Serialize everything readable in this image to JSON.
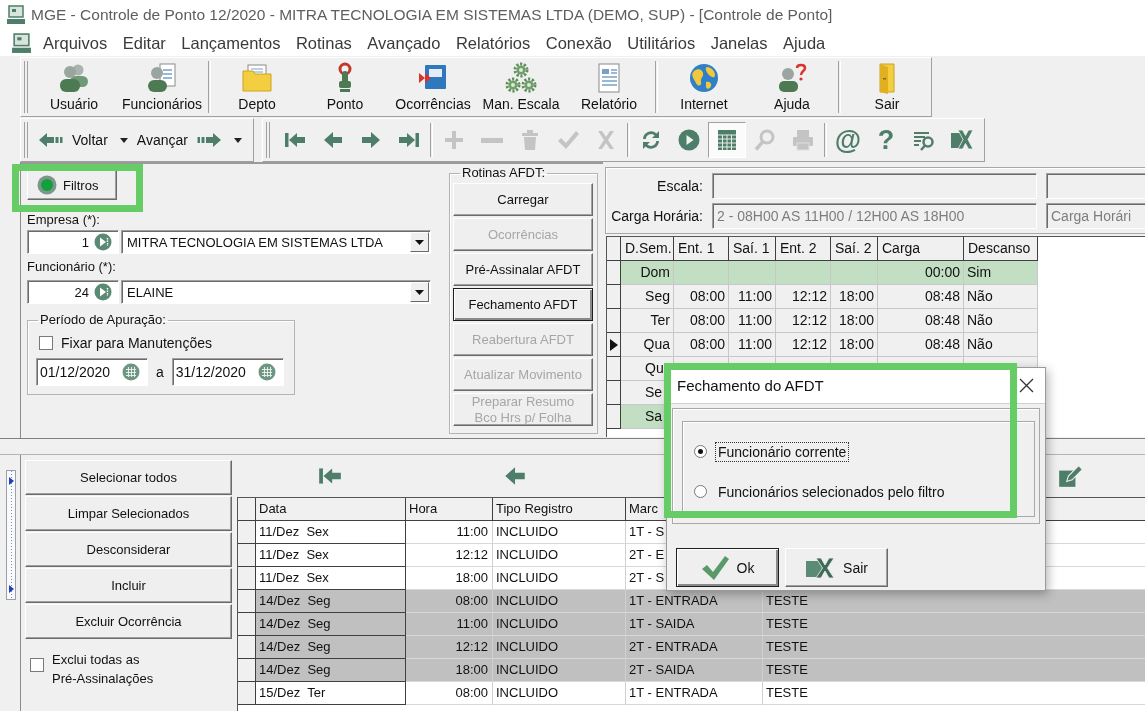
{
  "window": {
    "title": "MGE - Controle de Ponto 12/2020 - MITRA TECNOLOGIA EM SISTEMAS LTDA (DEMO, SUP) - [Controle de Ponto]"
  },
  "menu": [
    {
      "label": "Arquivos"
    },
    {
      "label": "Editar"
    },
    {
      "label": "Lançamentos"
    },
    {
      "label": "Rotinas"
    },
    {
      "label": "Avançado"
    },
    {
      "label": "Relatórios"
    },
    {
      "label": "Conexão"
    },
    {
      "label": "Utilitários"
    },
    {
      "label": "Janelas"
    },
    {
      "label": "Ajuda"
    }
  ],
  "main_toolbar": [
    [
      {
        "label": "Usuário",
        "kind": "users"
      },
      {
        "label": "Funcionários",
        "kind": "employees"
      }
    ],
    [
      {
        "label": "Depto",
        "kind": "department"
      },
      {
        "label": "Ponto",
        "kind": "punch"
      },
      {
        "label": "Ocorrências",
        "kind": "occurrences"
      },
      {
        "label": "Man. Escala",
        "kind": "schedule"
      },
      {
        "label": "Relatório",
        "kind": "report"
      }
    ],
    [
      {
        "label": "Internet",
        "kind": "internet"
      },
      {
        "label": "Ajuda",
        "kind": "help"
      }
    ],
    [
      {
        "label": "Sair",
        "kind": "exit"
      }
    ]
  ],
  "nav_toolbar": [
    {
      "label": "Voltar",
      "kind": "back"
    },
    {
      "label": "Avançar",
      "kind": "forward"
    }
  ],
  "record_toolbar": [
    [
      {
        "kind": "first",
        "disabled": false,
        "pressed": false
      },
      {
        "kind": "prev",
        "disabled": false,
        "pressed": false
      },
      {
        "kind": "next",
        "disabled": false,
        "pressed": false
      },
      {
        "kind": "last",
        "disabled": false,
        "pressed": false
      }
    ],
    [
      {
        "kind": "add",
        "disabled": true,
        "pressed": false
      },
      {
        "kind": "remove",
        "disabled": true,
        "pressed": false
      },
      {
        "kind": "delete",
        "disabled": true,
        "pressed": false
      },
      {
        "kind": "confirm",
        "disabled": true,
        "pressed": false
      },
      {
        "kind": "cancel",
        "disabled": true,
        "pressed": false
      }
    ],
    [
      {
        "kind": "refresh",
        "disabled": false,
        "pressed": false
      },
      {
        "kind": "run",
        "disabled": false,
        "pressed": false
      },
      {
        "kind": "grid",
        "disabled": false,
        "pressed": true
      },
      {
        "kind": "find",
        "disabled": true,
        "pressed": false
      },
      {
        "kind": "print",
        "disabled": true,
        "pressed": false
      }
    ],
    [
      {
        "kind": "email",
        "text": "@",
        "disabled": false,
        "pressed": false
      },
      {
        "kind": "help",
        "text": "?",
        "disabled": false,
        "pressed": false
      },
      {
        "kind": "search_list",
        "disabled": false,
        "pressed": false
      },
      {
        "kind": "export",
        "disabled": false,
        "pressed": false
      }
    ]
  ],
  "filters": {
    "button": {
      "label": "Filtros",
      "highlighted": true
    },
    "company": {
      "label": "Empresa (*):",
      "code": "1",
      "name": "MITRA TECNOLOGIA EM SISTEMAS LTDA"
    },
    "employee": {
      "label": "Funcionário (*):",
      "code": "24",
      "name": "ELAINE"
    },
    "period": {
      "title": "Período de Apuração:",
      "fixed": {
        "label": "Fixar para Manutenções",
        "checked": false
      },
      "from": "01/12/2020",
      "separator": "a",
      "to": "31/12/2020"
    }
  },
  "afdt_routines": {
    "title": "Rotinas AFDT:",
    "buttons": [
      {
        "label": "Carregar",
        "disabled": false,
        "focused": false
      },
      {
        "label": "Ocorrências",
        "disabled": true,
        "focused": false
      },
      {
        "label": "Pré-Assinalar AFDT",
        "disabled": false,
        "focused": false
      },
      {
        "label": "Fechamento AFDT",
        "disabled": false,
        "focused": true
      },
      {
        "label": "Reabertura AFDT",
        "disabled": true,
        "focused": false
      },
      {
        "label": "Atualizar Movimento",
        "disabled": true,
        "focused": false
      },
      {
        "label": "Preparar Resumo\nBco Hrs p/ Folha",
        "disabled": true,
        "focused": false
      }
    ]
  },
  "schedule": {
    "scale_label": "Escala:",
    "workload_label": "Carga Horária:",
    "workload": "2 - 08H00 AS 11H00 / 12H00 AS 18H00",
    "side_workload": "Carga Horári",
    "columns": [
      "D.Sem.",
      "Ent. 1",
      "Saí. 1",
      "Ent. 2",
      "Saí. 2",
      "Carga",
      "Descanso"
    ],
    "rows": [
      {
        "kind": "full",
        "day": "Dom",
        "carga": "00:00",
        "descanso": "Sim",
        "rest_day": true,
        "current": false
      },
      {
        "kind": "full",
        "day": "Seg",
        "ent_1": "08:00",
        "sai_1": "11:00",
        "ent_2": "12:12",
        "sai_2": "18:00",
        "carga": "08:48",
        "descanso": "Não",
        "rest_day": false,
        "current": false
      },
      {
        "kind": "full",
        "day": "Ter",
        "ent_1": "08:00",
        "sai_1": "11:00",
        "ent_2": "12:12",
        "sai_2": "18:00",
        "carga": "08:48",
        "descanso": "Não",
        "rest_day": false,
        "current": false
      },
      {
        "kind": "full",
        "day": "Qua",
        "ent_1": "08:00",
        "sai_1": "11:00",
        "ent_2": "12:12",
        "sai_2": "18:00",
        "carga": "08:48",
        "descanso": "Não",
        "rest_day": false,
        "current": true
      },
      {
        "kind": "covered",
        "day": "Qu",
        "rest_day": false,
        "current": false
      },
      {
        "kind": "covered",
        "day": "Se",
        "rest_day": false,
        "current": false
      },
      {
        "kind": "covered",
        "day": "Sa",
        "rest_day": true,
        "current": false
      }
    ]
  },
  "actions": {
    "buttons": [
      {
        "label": "Selecionar todos"
      },
      {
        "label": "Limpar Selecionados"
      },
      {
        "label": "Desconsiderar"
      },
      {
        "label": "Incluir"
      },
      {
        "label": "Excluir Ocorrência"
      }
    ],
    "exclude_all": {
      "label": "Exclui todas as Pré-Assinalações",
      "checked": false
    }
  },
  "records": {
    "columns": [
      "Data",
      "Hora",
      "Tipo Registro",
      "Marc"
    ],
    "rows": [
      {
        "data": "11/Dez  Sex",
        "hora": "11:00",
        "tipo": "INCLUIDO",
        "marc": "1T - S",
        "selected": false
      },
      {
        "data": "11/Dez  Sex",
        "hora": "12:12",
        "tipo": "INCLUIDO",
        "marc": "2T - E",
        "selected": false
      },
      {
        "data": "11/Dez  Sex",
        "hora": "18:00",
        "tipo": "INCLUIDO",
        "marc": "2T - S",
        "selected": false
      },
      {
        "data": "14/Dez  Seg",
        "hora": "08:00",
        "tipo": "INCLUIDO",
        "marc": "1T - ENTRADA",
        "column_5": "TESTE",
        "selected": true
      },
      {
        "data": "14/Dez  Seg",
        "hora": "11:00",
        "tipo": "INCLUIDO",
        "marc": "1T - SAIDA",
        "column_5": "TESTE",
        "selected": true
      },
      {
        "data": "14/Dez  Seg",
        "hora": "12:12",
        "tipo": "INCLUIDO",
        "marc": "2T - ENTRADA",
        "column_5": "TESTE",
        "selected": true
      },
      {
        "data": "14/Dez  Seg",
        "hora": "18:00",
        "tipo": "INCLUIDO",
        "marc": "2T - SAIDA",
        "column_5": "TESTE",
        "selected": true
      },
      {
        "data": "15/Dez  Ter",
        "hora": "08:00",
        "tipo": "INCLUIDO",
        "marc": "1T - ENTRADA",
        "column_5": "TESTE",
        "selected": false
      }
    ]
  },
  "dialog": {
    "title": "Fechamento do AFDT",
    "highlighted": true,
    "options": [
      {
        "label": "Funcionário corrente",
        "selected": true
      },
      {
        "label": "Funcionários selecionados pelo filtro",
        "selected": false
      }
    ],
    "buttons": [
      {
        "label": "Ok",
        "kind": "ok",
        "default": true
      },
      {
        "label": "Sair",
        "kind": "exit",
        "default": false
      }
    ]
  }
}
